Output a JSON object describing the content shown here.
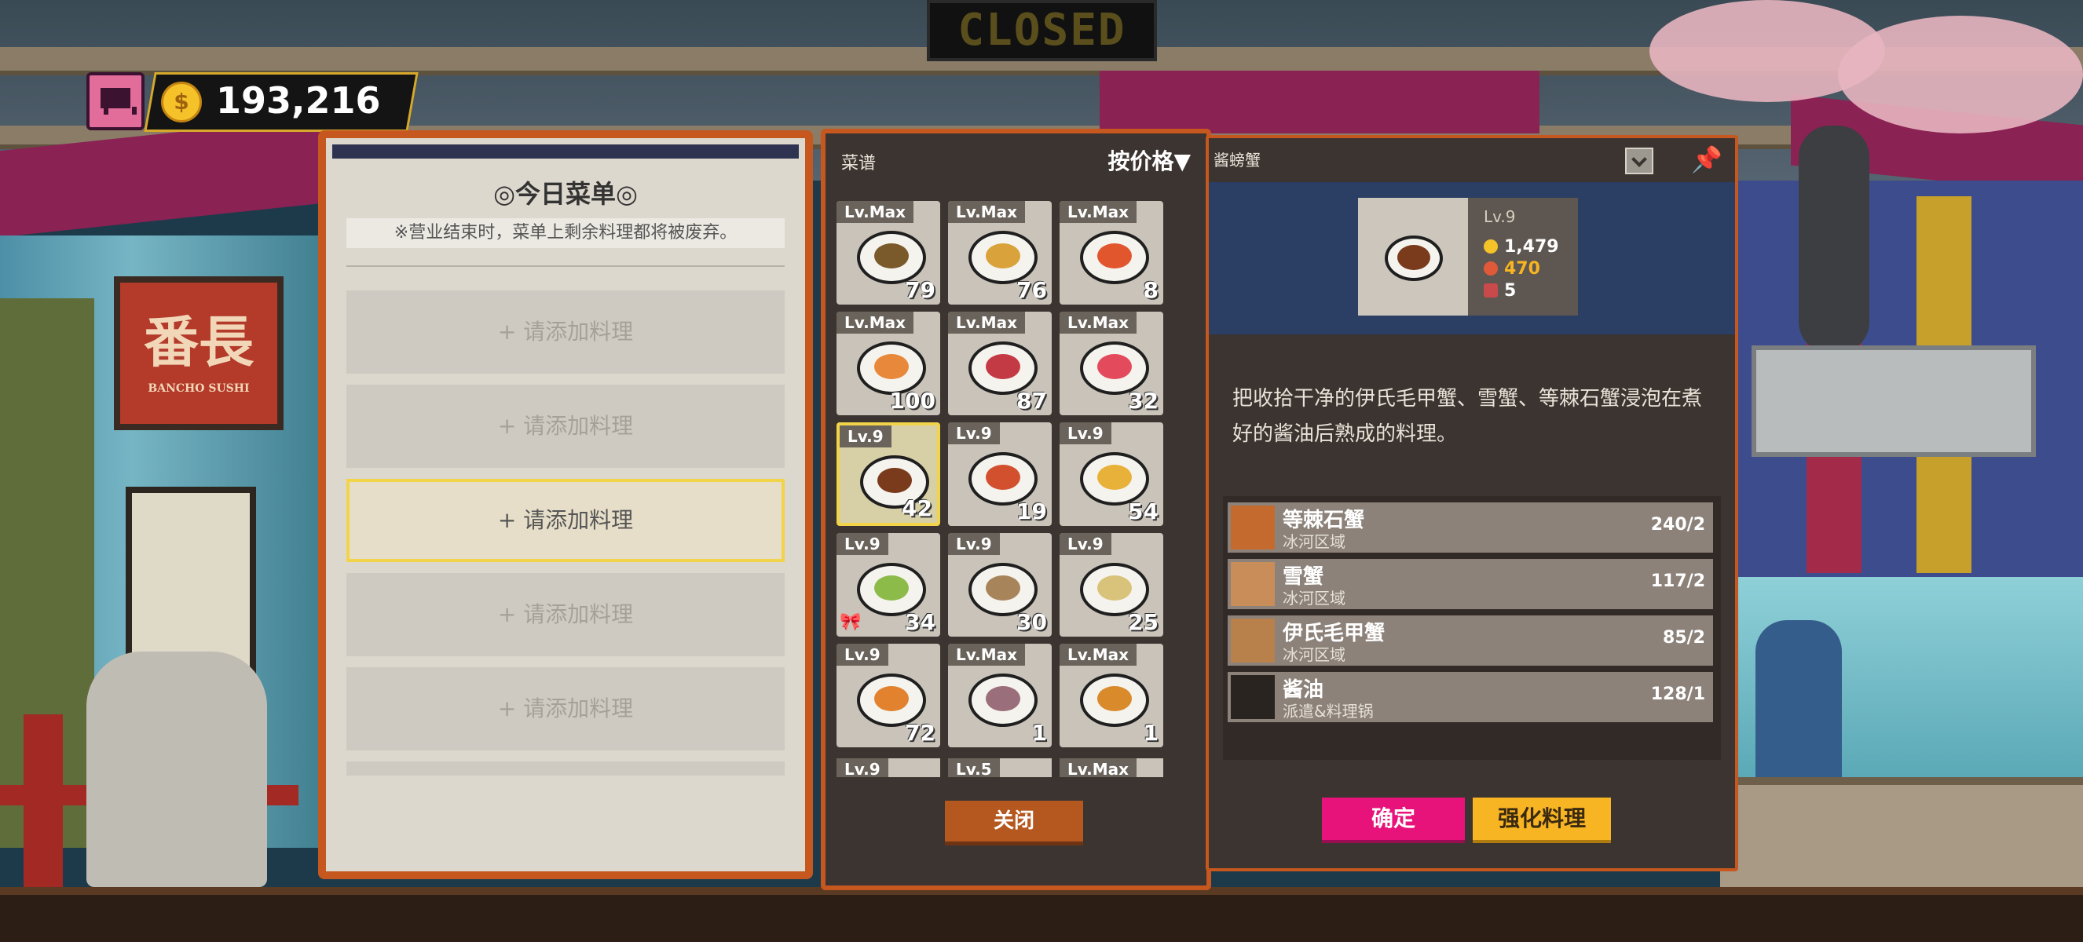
{
  "top_bar": {
    "gold_amount": "193,216",
    "coin_symbol": "$"
  },
  "background": {
    "closed_sign": "CLOSED",
    "restaurant_sign_main": "番長",
    "restaurant_sign_sub": "BANCHO SUSHI"
  },
  "menu_panel": {
    "title": "◎今日菜单◎",
    "notice": "※营业结束时，菜单上剩余料理都将被废弃。",
    "slots": [
      "+ 请添加料理",
      "+ 请添加料理",
      "+ 请添加料理",
      "+ 请添加料理",
      "+ 请添加料理"
    ]
  },
  "recipe_panel": {
    "title": "菜谱",
    "sort_label": "按价格▼",
    "cards": [
      {
        "level": "Lv.Max",
        "count": "79",
        "food_color": "#7a5a2a"
      },
      {
        "level": "Lv.Max",
        "count": "76",
        "food_color": "#d9a23a"
      },
      {
        "level": "Lv.Max",
        "count": "8",
        "food_color": "#e2562e"
      },
      {
        "level": "Lv.Max",
        "count": "100",
        "food_color": "#e8883a"
      },
      {
        "level": "Lv.Max",
        "count": "87",
        "food_color": "#c43a44"
      },
      {
        "level": "Lv.Max",
        "count": "32",
        "food_color": "#e34a5c"
      },
      {
        "level": "Lv.9",
        "count": "42",
        "food_color": "#7a3a1c"
      },
      {
        "level": "Lv.9",
        "count": "19",
        "food_color": "#d2502e"
      },
      {
        "level": "Lv.9",
        "count": "54",
        "food_color": "#e8b23a"
      },
      {
        "level": "Lv.9",
        "count": "34",
        "food_color": "#8dbb4a"
      },
      {
        "level": "Lv.9",
        "count": "30",
        "food_color": "#a8845a"
      },
      {
        "level": "Lv.9",
        "count": "25",
        "food_color": "#d9c27a"
      },
      {
        "level": "Lv.9",
        "count": "72",
        "food_color": "#e2822e"
      },
      {
        "level": "Lv.Max",
        "count": "1",
        "food_color": "#9a6e7a"
      },
      {
        "level": "Lv.Max",
        "count": "1",
        "food_color": "#d98a2a"
      }
    ],
    "partial_levels": [
      "Lv.9",
      "Lv.5",
      "Lv.Max"
    ],
    "close_label": "关闭"
  },
  "detail_panel": {
    "title": "酱螃蟹",
    "level": "Lv.9",
    "price": "1,479",
    "taste": "470",
    "portions": "5",
    "description": "把收拾干净的伊氏毛甲蟹、雪蟹、等棘石蟹浸泡在煮好的酱油后熟成的料理。",
    "ingredients": [
      {
        "name": "等棘石蟹",
        "location": "冰河区域",
        "quantity": "240/2"
      },
      {
        "name": "雪蟹",
        "location": "冰河区域",
        "quantity": "117/2"
      },
      {
        "name": "伊氏毛甲蟹",
        "location": "冰河区域",
        "quantity": "85/2"
      },
      {
        "name": "酱油",
        "location": "派遣&料理锅",
        "quantity": "128/1"
      }
    ],
    "confirm_label": "确定",
    "enhance_label": "强化料理"
  },
  "colors": {
    "panel_border": "#c6571e",
    "selection_highlight": "#f2d44a",
    "confirm_pink": "#e8137a",
    "enhance_yellow": "#f7b523",
    "taste_value": "#f7b523"
  }
}
